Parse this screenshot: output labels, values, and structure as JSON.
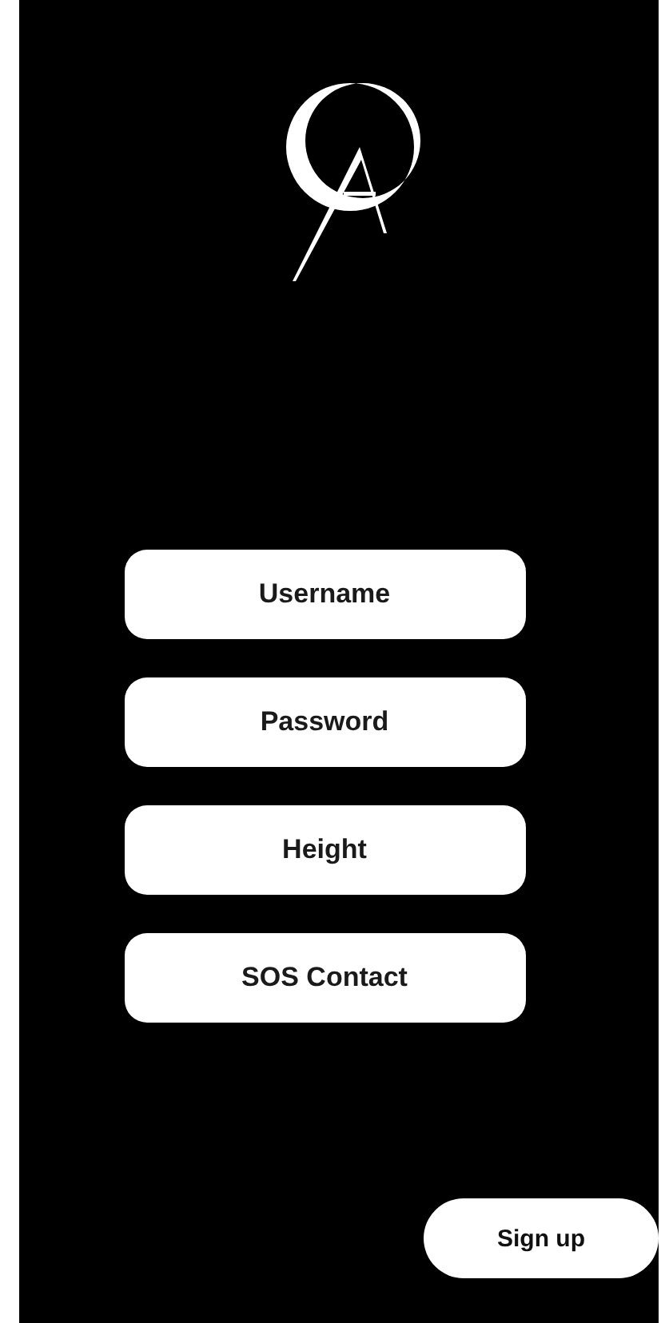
{
  "fields": [
    {
      "placeholder": "Username"
    },
    {
      "placeholder": "Password"
    },
    {
      "placeholder": "Height"
    },
    {
      "placeholder": "SOS Contact"
    }
  ],
  "submit": {
    "label": "Sign up"
  }
}
